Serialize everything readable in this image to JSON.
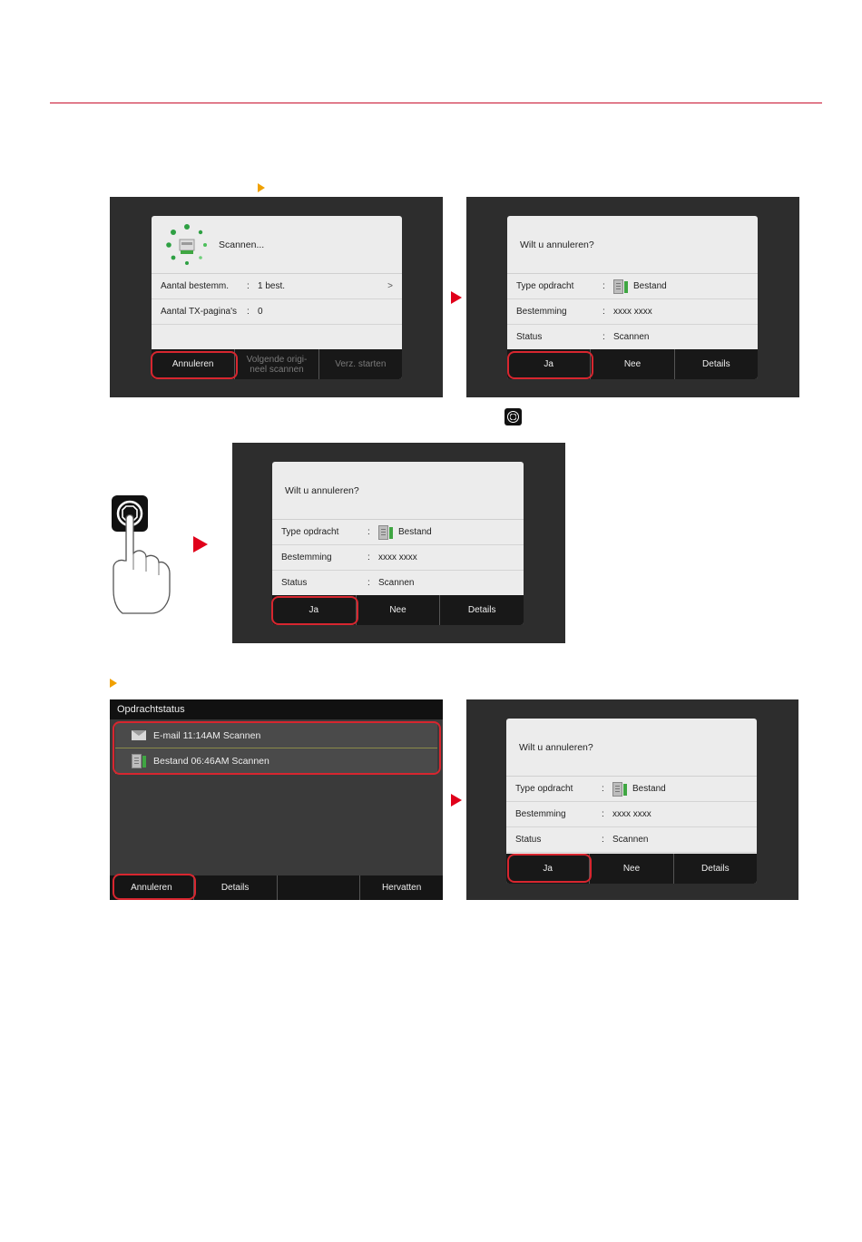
{
  "colors": {
    "accent_red": "#d7262f",
    "rule_red": "#c8102e",
    "marker_orange": "#f0a000",
    "screen_bg": "#2d2d2d"
  },
  "screen1": {
    "status": "Scannen...",
    "rows": [
      {
        "label": "Aantal bestemm.",
        "value": "1 best."
      },
      {
        "label": "Aantal TX-pagina's",
        "value": "0"
      }
    ],
    "buttons": {
      "cancel": "Annuleren",
      "next": "Volgende origi-\nneel scannen",
      "send": "Verz. starten"
    }
  },
  "confirm_dialog": {
    "question": "Wilt u annuleren?",
    "rows": [
      {
        "label": "Type opdracht",
        "value": "Bestand",
        "icon": "file-icon"
      },
      {
        "label": "Bestemming",
        "value": "xxxx xxxx"
      },
      {
        "label": "Status",
        "value": "Scannen"
      }
    ],
    "buttons": {
      "yes": "Ja",
      "no": "Nee",
      "details": "Details"
    }
  },
  "job_status": {
    "title": "Opdrachtstatus",
    "jobs": [
      {
        "icon": "mail-icon",
        "text": "E-mail 11:14AM Scannen"
      },
      {
        "icon": "file-icon",
        "text": "Bestand 06:46AM Scannen"
      }
    ],
    "buttons": {
      "cancel": "Annuleren",
      "details": "Details",
      "empty": "",
      "resume": "Hervatten"
    }
  },
  "icons": {
    "stop_key": "stop-key-icon",
    "hand": "pointing-hand-icon",
    "scan_animation": "scanning-spinner-icon"
  }
}
